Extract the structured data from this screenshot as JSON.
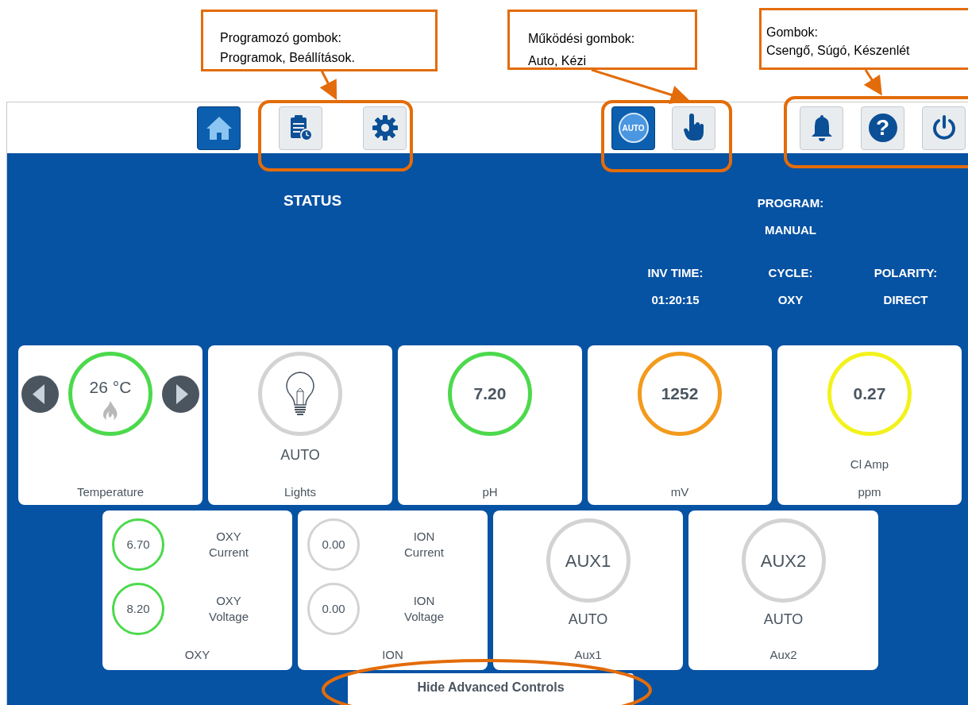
{
  "annotations": [
    {
      "lines": [
        "Programozó gombok:",
        "Programok, Beállítások."
      ]
    },
    {
      "lines": [
        "Működési gombok:",
        "Auto, Kézi"
      ]
    },
    {
      "lines": [
        "Gombok:",
        "Csengő, Súgó, Készenlét"
      ]
    }
  ],
  "toolbar": [
    {
      "kind": "home",
      "selected": true
    },
    {
      "kind": "programs",
      "selected": false
    },
    {
      "kind": "settings",
      "selected": false
    },
    {
      "kind": "auto",
      "label": "AUTO",
      "selected": true
    },
    {
      "kind": "manual",
      "selected": false
    },
    {
      "kind": "bell",
      "selected": false
    },
    {
      "kind": "help",
      "glyph": "?",
      "selected": false
    },
    {
      "kind": "power",
      "selected": false
    }
  ],
  "status": {
    "title": "STATUS",
    "program_label": "PROGRAM:",
    "program_value": "MANUAL",
    "info": [
      {
        "label": "INV TIME:",
        "value": "01:20:15"
      },
      {
        "label": "CYCLE:",
        "value": "OXY"
      },
      {
        "label": "POLARITY:",
        "value": "DIRECT"
      }
    ]
  },
  "cards_top": [
    {
      "kind": "temperature",
      "value": "26 °C",
      "color": "#4cd94c",
      "heating": true,
      "label": "Temperature"
    },
    {
      "kind": "lights",
      "mode": "AUTO",
      "color": "#d3d3d3",
      "label": "Lights"
    },
    {
      "kind": "reading",
      "value": "7.20",
      "color": "#4cd94c",
      "label": "pH"
    },
    {
      "kind": "reading",
      "value": "1252",
      "color": "#f39a1c",
      "label": "mV"
    },
    {
      "kind": "reading",
      "value": "0.27",
      "color": "#f2f21d",
      "sublabel": "Cl Amp",
      "label": "ppm"
    }
  ],
  "cards_bottom": [
    {
      "kind": "pair",
      "label": "OXY",
      "readings": [
        {
          "value": "6.70",
          "name": "OXY Current",
          "color": "#4cd94c"
        },
        {
          "value": "8.20",
          "name": "OXY Voltage",
          "color": "#4cd94c"
        }
      ]
    },
    {
      "kind": "pair",
      "label": "ION",
      "readings": [
        {
          "value": "0.00",
          "name": "ION Current",
          "color": "#d3d3d3"
        },
        {
          "value": "0.00",
          "name": "ION Voltage",
          "color": "#d3d3d3"
        }
      ]
    },
    {
      "kind": "aux",
      "name": "AUX1",
      "mode": "AUTO",
      "color": "#d3d3d3",
      "label": "Aux1"
    },
    {
      "kind": "aux",
      "name": "AUX2",
      "mode": "AUTO",
      "color": "#d3d3d3",
      "label": "Aux2"
    }
  ],
  "hide_button": "Hide Advanced Controls"
}
